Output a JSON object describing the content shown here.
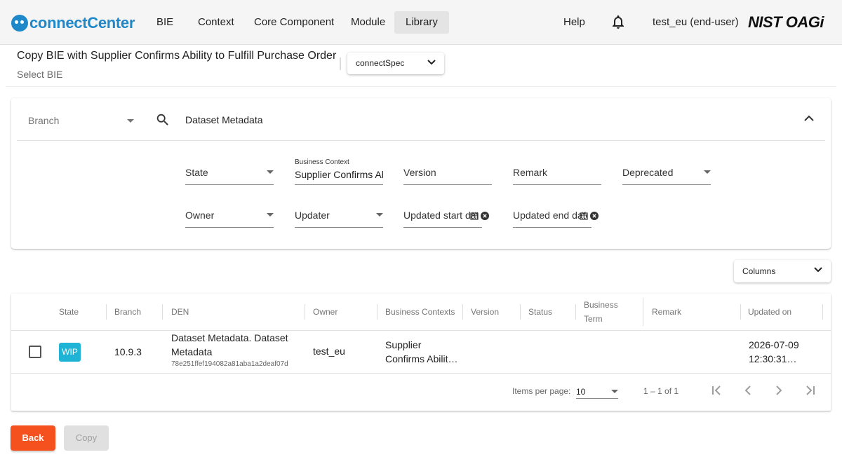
{
  "header": {
    "logo_text": "connectCenter",
    "nav": [
      "BIE",
      "Context",
      "Core Component",
      "Module",
      "Library"
    ],
    "help_label": "Help",
    "user_label": "test_eu (end-user)",
    "brand_text": "NIST OAGi"
  },
  "page": {
    "title": "Copy BIE with Supplier Confirms Ability to Fulfill Purchase Order",
    "subtitle": "Select BIE",
    "release_value": "connectSpec"
  },
  "search": {
    "branch_label": "Branch",
    "query": "Dataset Metadata",
    "state_label": "State",
    "business_context_label": "Business Context",
    "business_context_value": "Supplier Confirms Ability to Fulfill Purchase Order",
    "version_label": "Version",
    "remark_label": "Remark",
    "deprecated_label": "Deprecated",
    "owner_label": "Owner",
    "updater_label": "Updater",
    "updated_start_label": "Updated start date",
    "updated_end_label": "Updated end date"
  },
  "columns_button": "Columns",
  "table": {
    "headers": {
      "state": "State",
      "branch": "Branch",
      "den": "DEN",
      "owner": "Owner",
      "business_contexts": "Business Contexts",
      "version": "Version",
      "status": "Status",
      "business_term_line1": "Business",
      "business_term_line2": "Term",
      "remark": "Remark",
      "updated_on": "Updated on"
    },
    "row": {
      "state": "WIP",
      "branch": "10.9.3",
      "den_line1": "Dataset Metadata. Dataset",
      "den_line2": "Metadata",
      "den_id": "78e251ffef194082a81aba1a2deaf07d",
      "owner": "test_eu",
      "business_context_line1": "Supplier",
      "business_context_line2": "Confirms Abilit…",
      "updated_line1": "2026-07-09",
      "updated_line2": "12:30:31…"
    },
    "paginator": {
      "items_per_page_label": "Items per page:",
      "items_per_page_value": "10",
      "range": "1 – 1 of 1"
    }
  },
  "actions": {
    "back": "Back",
    "copy": "Copy"
  },
  "colors": {
    "primary": "#1e88c9",
    "wip": "#1fb3d6",
    "back": "#f4511e"
  }
}
